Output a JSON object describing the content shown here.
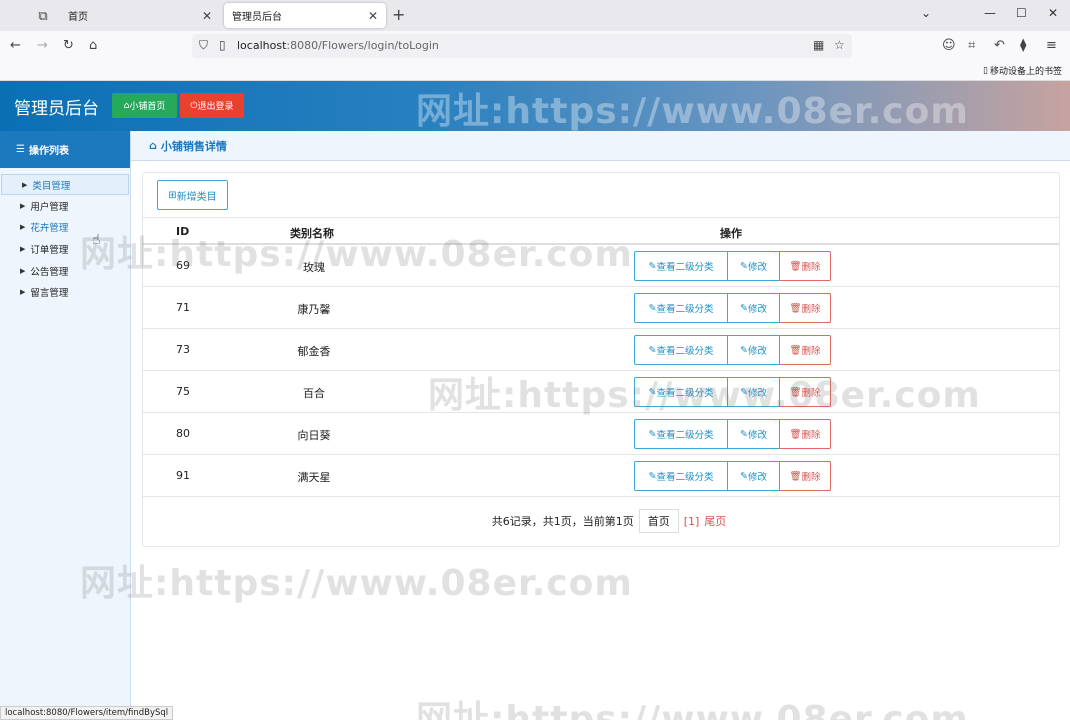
{
  "browser": {
    "tabs": [
      {
        "title": "首页",
        "close": "✕"
      },
      {
        "title": "管理员后台",
        "close": "✕"
      }
    ],
    "new_tab": "+",
    "url_host": "localhost",
    "url_rest": ":8080/Flowers/login/toLogin",
    "bookmark_mobile": "移动设备上的书签",
    "status_url": "localhost:8080/Flowers/item/findBySql"
  },
  "header": {
    "title": "管理员后台",
    "home_button": "小铺首页",
    "logout_button": "退出登录"
  },
  "sidebar": {
    "heading": "操作列表",
    "items": [
      {
        "label": "类目管理"
      },
      {
        "label": "用户管理"
      },
      {
        "label": "花卉管理"
      },
      {
        "label": "订单管理"
      },
      {
        "label": "公告管理"
      },
      {
        "label": "留言管理"
      }
    ]
  },
  "main": {
    "heading": "小铺销售详情",
    "add_button": "新增类目",
    "columns": {
      "id": "ID",
      "name": "类别名称",
      "actions": "操作"
    },
    "actions": {
      "view": "查看二级分类",
      "edit": "修改",
      "delete": "删除"
    },
    "rows": [
      {
        "id": "69",
        "name": "玫瑰"
      },
      {
        "id": "71",
        "name": "康乃馨"
      },
      {
        "id": "73",
        "name": "郁金香"
      },
      {
        "id": "75",
        "name": "百合"
      },
      {
        "id": "80",
        "name": "向日葵"
      },
      {
        "id": "91",
        "name": "满天星"
      }
    ],
    "pager": {
      "summary": "共6记录，共1页，当前第1页",
      "first": "首页",
      "current": "[1]",
      "last": "尾页"
    }
  },
  "watermark": "网址:https://www.08er.com",
  "colors": {
    "brand_blue": "#1d79be",
    "green": "#27a95c",
    "red": "#e8412e"
  }
}
